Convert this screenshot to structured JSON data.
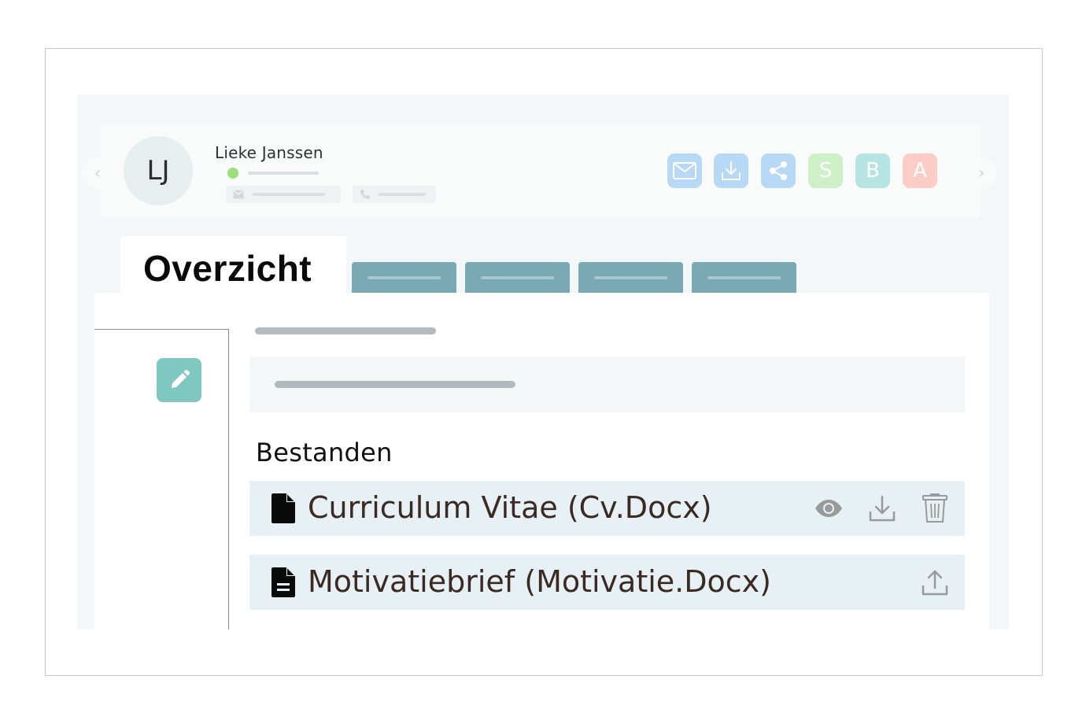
{
  "candidate": {
    "initials": "LJ",
    "name": "Lieke Janssen",
    "status_color": "#9be07c"
  },
  "nav": {
    "prev_icon": "chevron-left-icon",
    "next_icon": "chevron-right-icon",
    "prev_glyph": "‹",
    "next_glyph": "›"
  },
  "actions": [
    {
      "name": "mail",
      "icon": "mail-icon",
      "color": "#b7d9f6"
    },
    {
      "name": "download",
      "icon": "download-icon",
      "color": "#b7d9f6"
    },
    {
      "name": "share",
      "icon": "share-icon",
      "color": "#b7d9f6"
    },
    {
      "name": "s",
      "label": "S",
      "color": "#cdf0c6"
    },
    {
      "name": "b",
      "label": "B",
      "color": "#b5e4e2"
    },
    {
      "name": "a",
      "label": "A",
      "color": "#fbcdc6"
    }
  ],
  "tabs": {
    "active_label": "Overzicht"
  },
  "main": {
    "files_section_title": "Bestanden",
    "files": [
      {
        "name": "Curriculum Vitae (Cv.Docx)",
        "actions": [
          "eye-icon",
          "download-icon",
          "trash-icon"
        ]
      },
      {
        "name": "Motivatiebrief (Motivatie.Docx)",
        "actions": [
          "upload-icon"
        ]
      }
    ]
  },
  "colors": {
    "accent": "#7ec8c1",
    "tab_inactive": "#7aa9b6",
    "file_row_bg": "#e6f0f5"
  }
}
